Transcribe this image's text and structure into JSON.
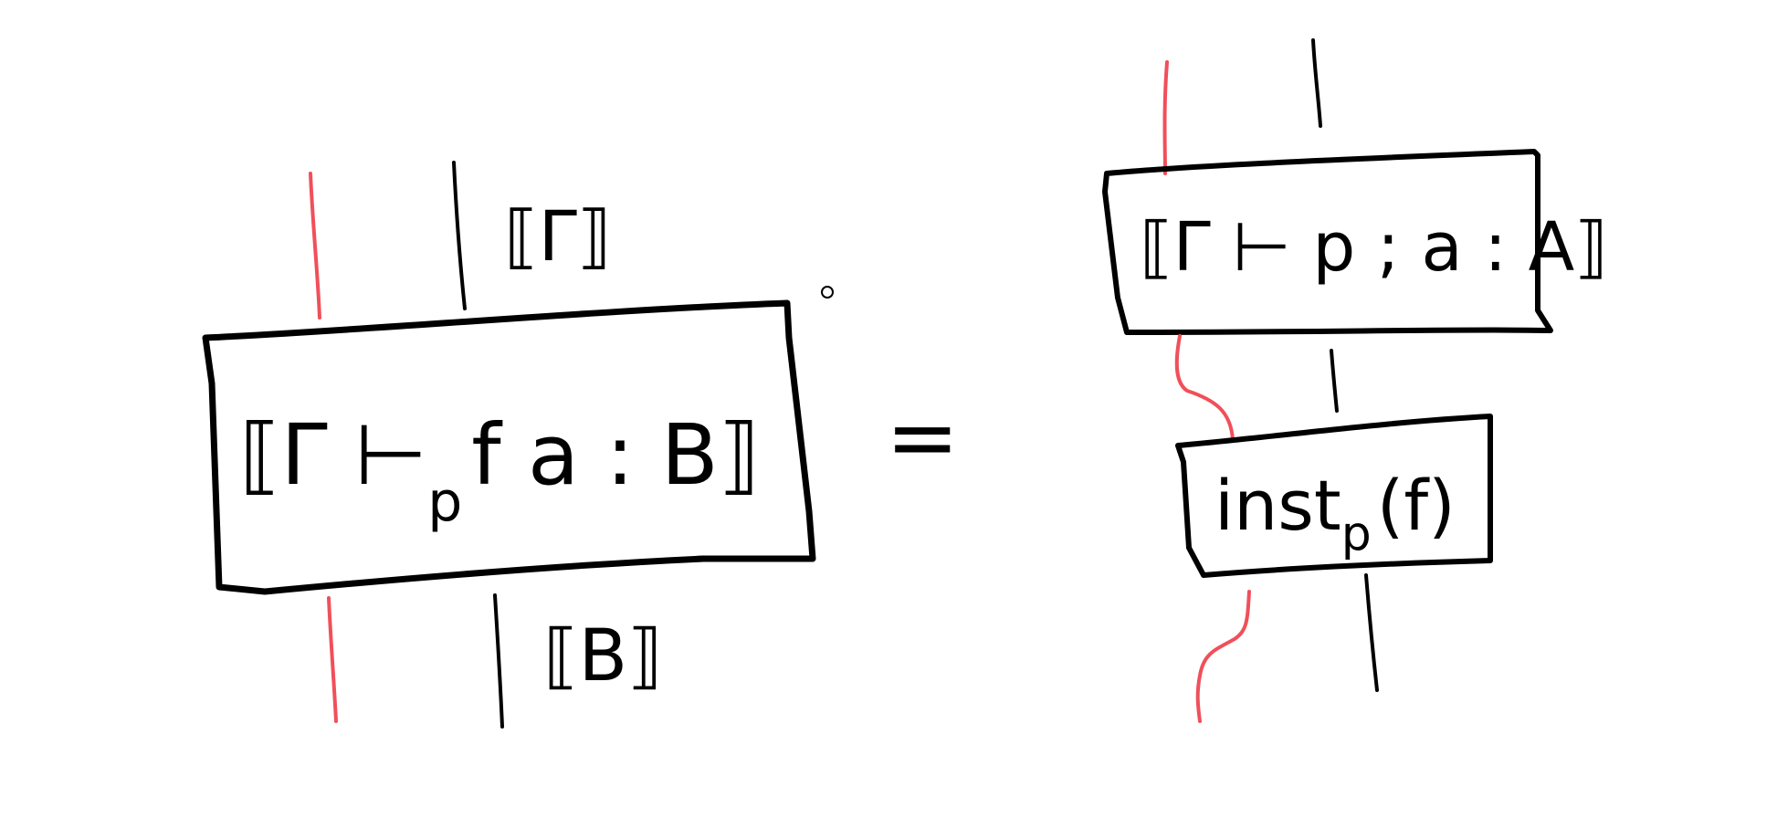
{
  "colors": {
    "ink": "#000000",
    "wire_red": "#f0505a",
    "background": "#ffffff"
  },
  "left": {
    "input_label": "⟦Γ⟧",
    "box_label": {
      "open": "⟦Γ ⊢",
      "sub": "p",
      "rest": "f a : B⟧"
    },
    "output_label": "⟦B⟧"
  },
  "equals": "=",
  "right": {
    "top_box_label": "⟦Γ ⊢ p ; a : A⟧",
    "bottom_box_label": {
      "main": "inst",
      "sub": "p",
      "args": "(f)"
    }
  }
}
